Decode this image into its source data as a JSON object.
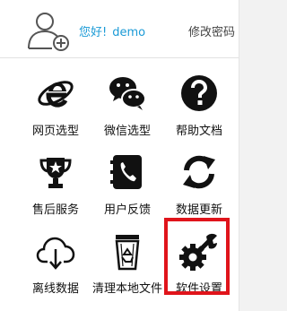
{
  "header": {
    "greeting": "您好!",
    "username": "demo",
    "change_password": "修改密码"
  },
  "menu": [
    {
      "label": "网页选型",
      "icon": "ie-browser-icon"
    },
    {
      "label": "微信选型",
      "icon": "wechat-icon"
    },
    {
      "label": "帮助文档",
      "icon": "help-icon"
    },
    {
      "label": "售后服务",
      "icon": "trophy-icon"
    },
    {
      "label": "用户反馈",
      "icon": "phone-book-icon"
    },
    {
      "label": "数据更新",
      "icon": "sync-icon"
    },
    {
      "label": "离线数据",
      "icon": "cloud-download-icon"
    },
    {
      "label": "清理本地文件",
      "icon": "recycle-bin-icon"
    },
    {
      "label": "软件设置",
      "icon": "settings-tools-icon"
    }
  ],
  "colors": {
    "accent": "#1a9ad6",
    "highlight": "#e0141b",
    "icon": "#111111"
  }
}
